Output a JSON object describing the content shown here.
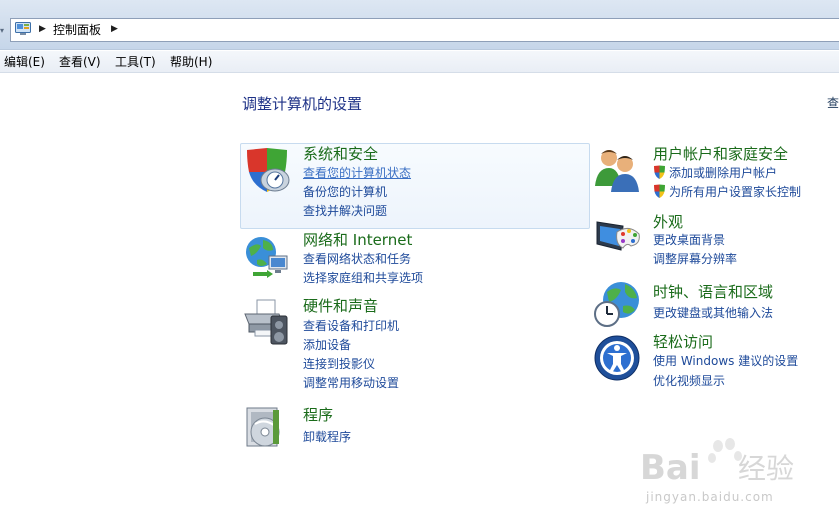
{
  "window": {
    "breadcrumb": [
      "控制面板"
    ]
  },
  "menu": [
    {
      "label": "编辑(E)"
    },
    {
      "label": "查看(V)"
    },
    {
      "label": "工具(T)"
    },
    {
      "label": "帮助(H)"
    }
  ],
  "page": {
    "title": "调整计算机的设置",
    "view_by": "查"
  },
  "categories": {
    "system": {
      "title": "系统和安全",
      "links": [
        "查看您的计算机状态",
        "备份您的计算机",
        "查找并解决问题"
      ],
      "icon": "shield-icon"
    },
    "network": {
      "title": "网络和 Internet",
      "links": [
        "查看网络状态和任务",
        "选择家庭组和共享选项"
      ],
      "icon": "network-globe-icon"
    },
    "hardware": {
      "title": "硬件和声音",
      "links": [
        "查看设备和打印机",
        "添加设备",
        "连接到投影仪",
        "调整常用移动设置"
      ],
      "icon": "printer-icon"
    },
    "programs": {
      "title": "程序",
      "links": [
        "卸载程序"
      ],
      "icon": "programs-disc-icon"
    },
    "users": {
      "title": "用户帐户和家庭安全",
      "links": [
        "添加或删除用户帐户",
        "为所有用户设置家长控制"
      ],
      "icon": "users-icon"
    },
    "appearance": {
      "title": "外观",
      "links": [
        "更改桌面背景",
        "调整屏幕分辨率"
      ],
      "icon": "monitor-palette-icon"
    },
    "clock": {
      "title": "时钟、语言和区域",
      "links": [
        "更改键盘或其他输入法"
      ],
      "icon": "clock-globe-icon"
    },
    "ease": {
      "title": "轻松访问",
      "links": [
        "使用 Windows 建议的设置",
        "优化视频显示"
      ],
      "icon": "ease-of-access-icon"
    }
  },
  "watermark": {
    "brand": "Bai",
    "brand2": "经验",
    "url": "jingyan.baidu.com"
  },
  "colors": {
    "title_green": "#1a6b1a",
    "link_blue": "#1e4a9a",
    "heading_blue": "#1e3287"
  }
}
